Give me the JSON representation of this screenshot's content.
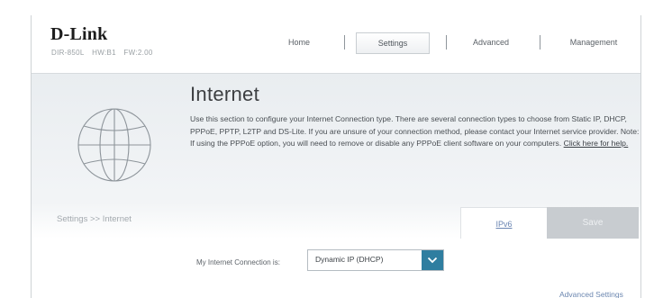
{
  "brand": {
    "logo": "D-Link",
    "model_parts": [
      "DIR-850L",
      "HW:B1",
      "FW:2.00"
    ]
  },
  "nav": {
    "items": [
      {
        "label": "Home"
      },
      {
        "label": "Settings"
      },
      {
        "label": "Advanced"
      },
      {
        "label": "Management"
      }
    ],
    "active": "Settings"
  },
  "banner": {
    "title": "Internet",
    "description": "Use this section to configure your Internet Connection type. There are several connection types to choose from Static IP, DHCP, PPPoE, PPTP, L2TP and DS-Lite. If you are unsure of your connection method, please contact your Internet service provider. Note: If using the PPPoE option, you will need to remove or disable any PPPoE client software on your computers.",
    "help_link": "Click here for help."
  },
  "toolbar": {
    "breadcrumb": "Settings >> Internet",
    "ipv6_tab": "IPv6",
    "save_label": "Save"
  },
  "form": {
    "connection_label": "My Internet Connection is:",
    "connection_value": "Dynamic IP (DHCP)",
    "advanced_link": "Advanced Settings"
  },
  "colors": {
    "accent": "#2f7ea0",
    "link": "#6c87b0",
    "save_disabled": "#c8ccd0"
  },
  "icons": {
    "banner": "globe-icon",
    "select": "chevron-down-icon"
  }
}
